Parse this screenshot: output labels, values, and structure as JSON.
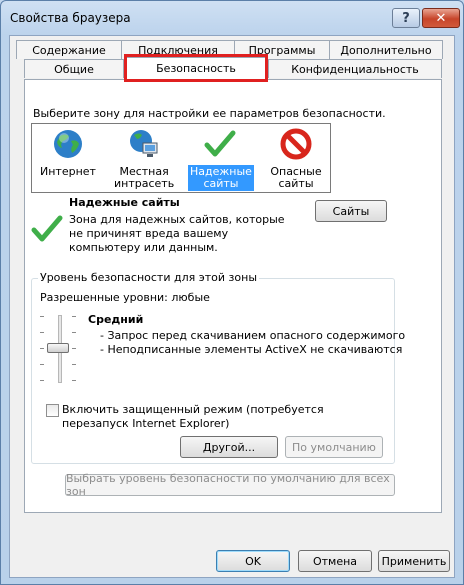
{
  "window": {
    "title": "Свойства браузера",
    "help_label": "?",
    "close_label": "✕"
  },
  "tabs": {
    "row_back": [
      "Содержание",
      "Подключения",
      "Программы",
      "Дополнительно"
    ],
    "row_front": [
      "Общие",
      "Безопасность",
      "Конфиденциальность"
    ],
    "active": "Безопасность"
  },
  "security": {
    "zone_prompt": "Выберите зону для настройки ее параметров безопасности.",
    "zones": [
      {
        "label_line1": "Интернет",
        "label_line2": "",
        "icon": "globe-icon"
      },
      {
        "label_line1": "Местная",
        "label_line2": "интрасеть",
        "icon": "intranet-icon"
      },
      {
        "label_line1": "Надежные",
        "label_line2": "сайты",
        "icon": "checkmark-icon",
        "selected": true
      },
      {
        "label_line1": "Опасные",
        "label_line2": "сайты",
        "icon": "restricted-icon"
      }
    ],
    "selected_zone_title": "Надежные сайты",
    "selected_zone_desc": "Зона для надежных сайтов, которые не причинят вреда вашему компьютеру или данным.",
    "sites_button": "Сайты",
    "level_group_title": "Уровень безопасности для этой зоны",
    "allowed_levels": "Разрешенные уровни: любые",
    "level_name": "Средний",
    "level_items": [
      "- Запрос перед скачиванием опасного содержимого",
      "- Неподписанные элементы ActiveX не скачиваются"
    ],
    "protected_mode_label": "Включить защищенный режим (потребуется перезапуск Internet Explorer)",
    "protected_mode_checked": false,
    "custom_button": "Другой...",
    "default_button": "По умолчанию",
    "reset_all_button": "Выбрать уровень безопасности по умолчанию для всех зон"
  },
  "footer": {
    "ok": "OK",
    "cancel": "Отмена",
    "apply": "Применить"
  },
  "colors": {
    "highlight": "#e02020",
    "selection": "#3399ff",
    "check_green": "#3fae49",
    "restricted_red": "#d8261c"
  }
}
